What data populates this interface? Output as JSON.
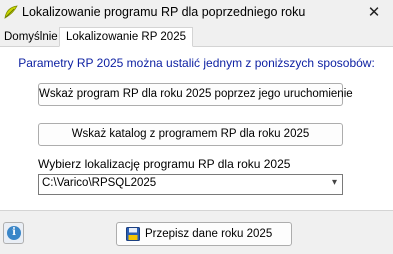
{
  "window": {
    "title": "Lokalizowanie programu RP dla poprzedniego roku",
    "close_glyph": "✕",
    "icon": "rp-app-icon"
  },
  "tabs": [
    {
      "label": "Domyślnie",
      "active": false
    },
    {
      "label": "Lokalizowanie RP 2025",
      "active": true
    }
  ],
  "panel": {
    "heading": "Parametry RP 2025 można ustalić jednym z poniższych sposobów:",
    "run_button_label": "Wskaż program RP dla roku 2025 poprzez jego uruchomienie",
    "dir_button_label": "Wskaż katalog z programem RP dla roku 2025",
    "location_label": "Wybierz lokalizację programu RP dla roku 2025",
    "location_value": "C:\\Varico\\RPSQL2025",
    "dropdown_glyph": "▾"
  },
  "footer": {
    "info_glyph": "i",
    "copy_button_label": "Przepisz dane roku 2025"
  },
  "colors": {
    "heading": "#0f22a3",
    "info": "#3a86c8"
  }
}
